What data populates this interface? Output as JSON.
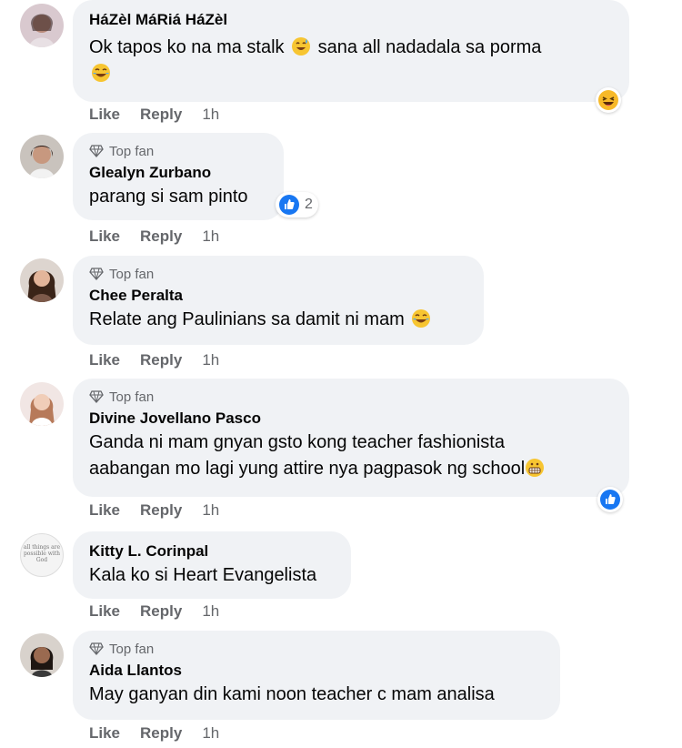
{
  "ui": {
    "like_label": "Like",
    "reply_label": "Reply",
    "topfan_label": "Top fan"
  },
  "comments": [
    {
      "name": "HáZèl MáRiá HáZèl",
      "text": "Ok tapos ko na ma stalk",
      "text2": "sana all nadadala sa porma",
      "time": "1h"
    },
    {
      "name": "Glealyn Zurbano",
      "text": "parang si sam pinto",
      "reaction_count": "2",
      "time": "1h"
    },
    {
      "name": "Chee Peralta",
      "text": "Relate ang Paulinians sa damit ni mam",
      "time": "1h"
    },
    {
      "name": "Divine Jovellano Pasco",
      "text": "Ganda ni mam gnyan gsto kong teacher fashionista",
      "text2": "aabangan mo lagi yung attire nya pagpasok ng school",
      "time": "1h"
    },
    {
      "name": "Kitty L. Corinpal",
      "text": "Kala ko si Heart Evangelista",
      "avatar_text": "all things are possible with God",
      "time": "1h"
    },
    {
      "name": "Aida Llantos",
      "text": "May ganyan din kami noon teacher c mam analisa",
      "time": "1h"
    }
  ]
}
